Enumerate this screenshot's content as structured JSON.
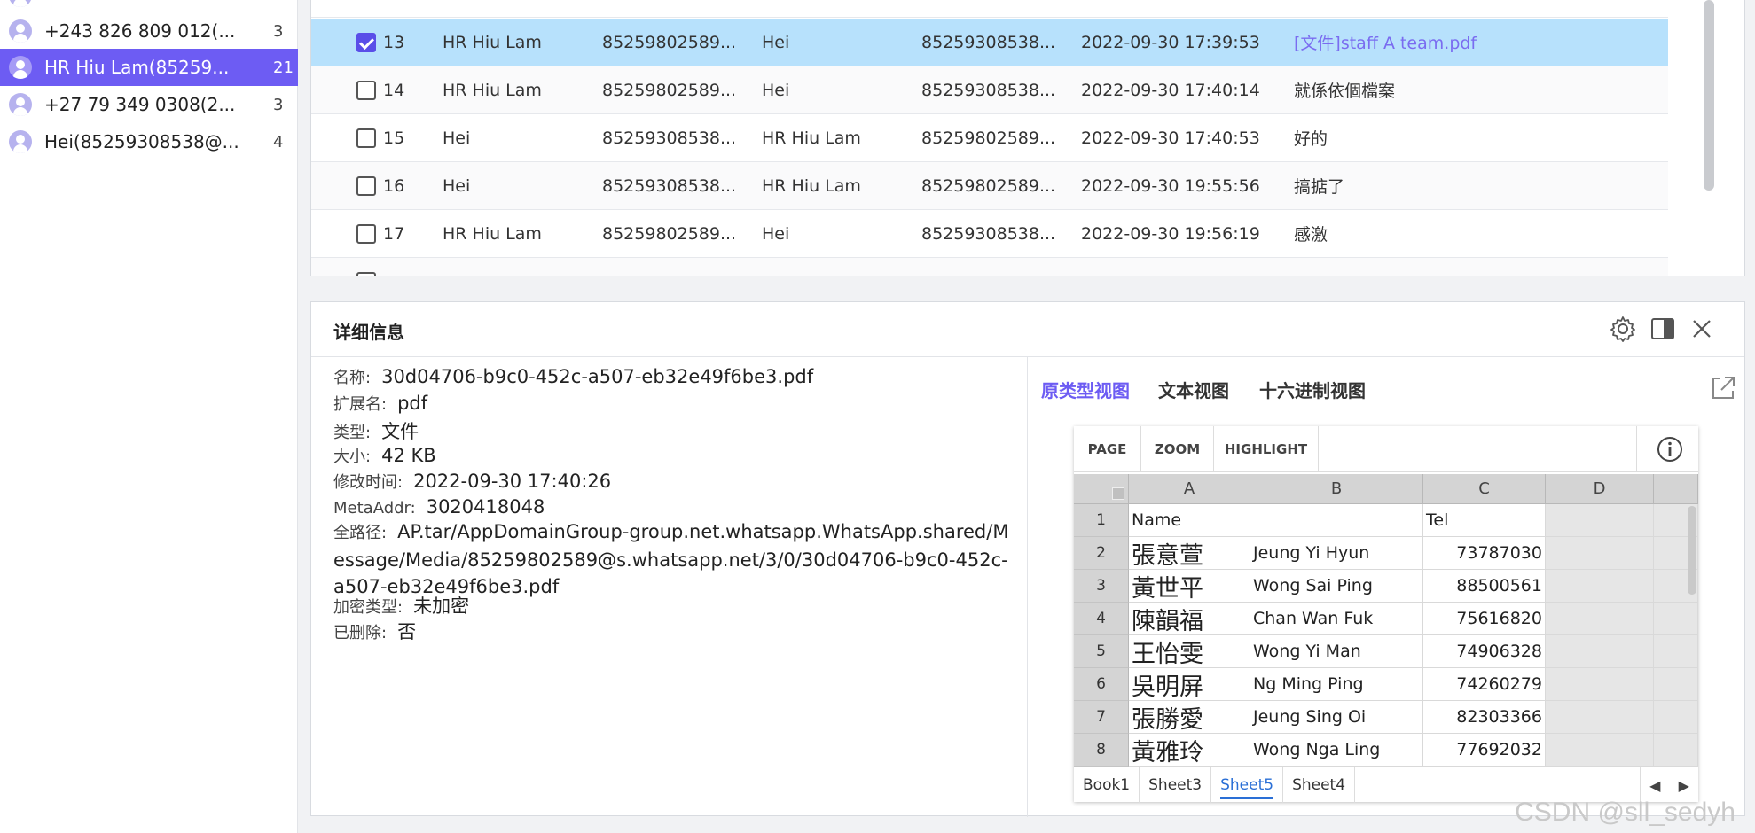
{
  "sidebar": {
    "contacts": [
      {
        "name": "+243 826 809 012(...",
        "count": "3"
      },
      {
        "name": "HR Hiu Lam(85259...",
        "count": "21"
      },
      {
        "name": "+27 79 349 0308(2...",
        "count": "3"
      },
      {
        "name": "Hei(85259308538@...",
        "count": "4"
      }
    ]
  },
  "messages": [
    {
      "num": "13",
      "from": "HR Hiu Lam",
      "from_id": "85259802589...",
      "to": "Hei",
      "to_id": "85259308538...",
      "time": "2022-09-30 17:39:53",
      "content": "[文件]staff A team.pdf",
      "checked": true
    },
    {
      "num": "14",
      "from": "HR Hiu Lam",
      "from_id": "85259802589...",
      "to": "Hei",
      "to_id": "85259308538...",
      "time": "2022-09-30 17:40:14",
      "content": "就係依個檔案",
      "checked": false
    },
    {
      "num": "15",
      "from": "Hei",
      "from_id": "85259308538...",
      "to": "HR Hiu Lam",
      "to_id": "85259802589...",
      "time": "2022-09-30 17:40:53",
      "content": "好的",
      "checked": false
    },
    {
      "num": "16",
      "from": "Hei",
      "from_id": "85259308538...",
      "to": "HR Hiu Lam",
      "to_id": "85259802589...",
      "time": "2022-09-30 19:55:56",
      "content": "搞掂了",
      "checked": false
    },
    {
      "num": "17",
      "from": "HR Hiu Lam",
      "from_id": "85259802589...",
      "to": "Hei",
      "to_id": "85259308538...",
      "time": "2022-09-30 19:56:19",
      "content": "感激",
      "checked": false
    }
  ],
  "detail": {
    "title": "详细信息",
    "fields": {
      "name_label": "名称:",
      "name_value": "30d04706-b9c0-452c-a507-eb32e49f6be3.pdf",
      "ext_label": "扩展名:",
      "ext_value": "pdf",
      "type_label": "类型:",
      "type_value": "文件",
      "size_label": "大小:",
      "size_value": "42 KB",
      "mtime_label": "修改时间:",
      "mtime_value": "2022-09-30 17:40:26",
      "meta_label": "MetaAddr:",
      "meta_value": "3020418048",
      "path_label": "全路径:",
      "path_value": "AP.tar/AppDomainGroup-group.net.whatsapp.WhatsApp.shared/Message/Media/85259802589@s.whatsapp.net/3/0/30d04706-b9c0-452c-a507-eb32e49f6be3.pdf",
      "enc_label": "加密类型:",
      "enc_value": "未加密",
      "del_label": "已删除:",
      "del_value": "否"
    },
    "view_tabs": {
      "raw": "原类型视图",
      "text": "文本视图",
      "hex": "十六进制视图"
    }
  },
  "viewer": {
    "toolbar": {
      "page": "PAGE",
      "zoom": "ZOOM",
      "highlight": "HIGHLIGHT"
    },
    "columns": [
      "A",
      "B",
      "C",
      "D"
    ],
    "rows": [
      {
        "n": "1",
        "a": "Name",
        "b": "",
        "c": "Tel"
      },
      {
        "n": "2",
        "a": "張意萱",
        "b": "Jeung Yi Hyun",
        "c": "73787030"
      },
      {
        "n": "3",
        "a": "黃世平",
        "b": "Wong Sai Ping",
        "c": "88500561"
      },
      {
        "n": "4",
        "a": "陳韻福",
        "b": "Chan Wan Fuk",
        "c": "75616820"
      },
      {
        "n": "5",
        "a": "王怡雯",
        "b": "Wong Yi Man",
        "c": "74906328"
      },
      {
        "n": "6",
        "a": "吳明屏",
        "b": "Ng Ming Ping",
        "c": "74260279"
      },
      {
        "n": "7",
        "a": "張勝愛",
        "b": "Jeung Sing Oi",
        "c": "82303366"
      },
      {
        "n": "8",
        "a": "黃雅玲",
        "b": "Wong Nga Ling",
        "c": "77692032"
      }
    ],
    "sheets": [
      "Book1",
      "Sheet3",
      "Sheet5",
      "Sheet4"
    ],
    "active_sheet": "Sheet5"
  },
  "watermark": "CSDN @sll_sedyh",
  "colors": {
    "accent": "#6d5cf3",
    "selected_row": "#b7e1fc",
    "link": "#7a6cf0"
  }
}
